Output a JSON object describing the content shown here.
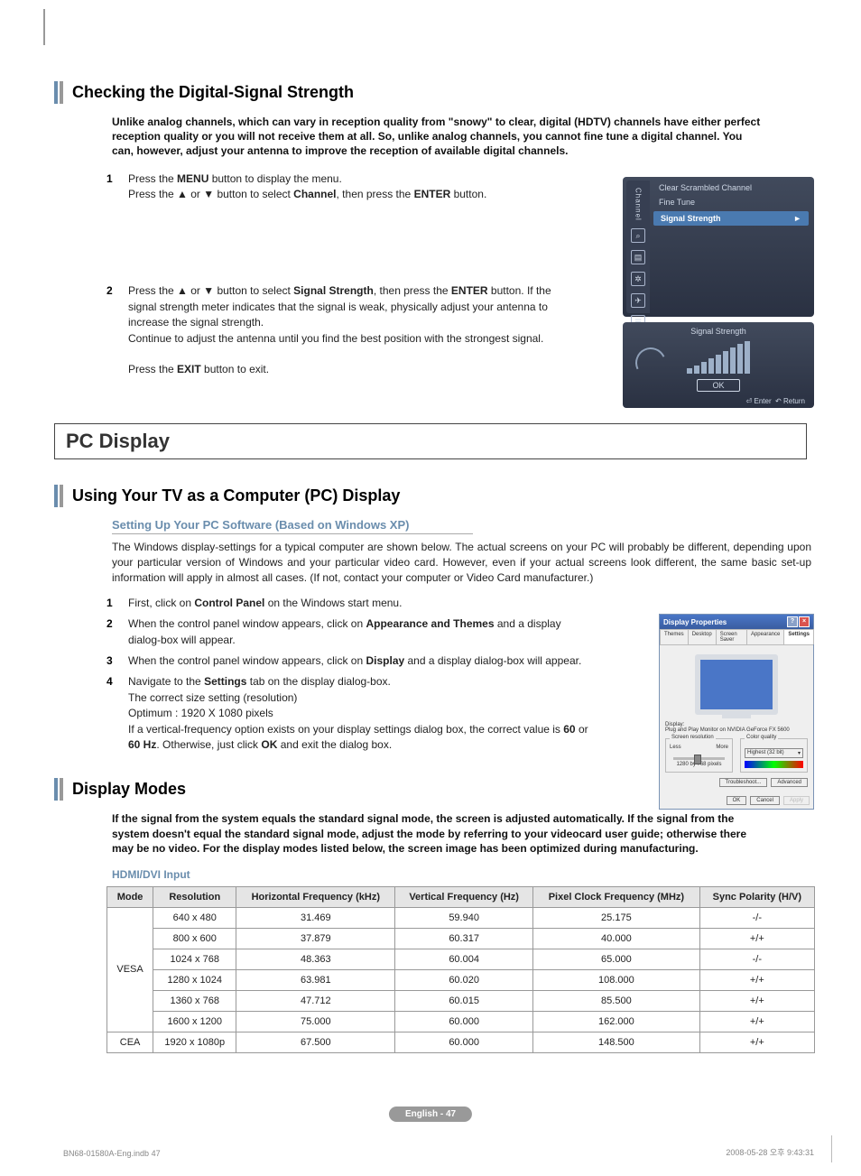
{
  "section1": {
    "title": "Checking the Digital-Signal Strength",
    "intro": "Unlike analog channels, which can vary in reception quality from \"snowy\" to clear, digital (HDTV) channels have either perfect reception quality or you will not receive them at all. So, unlike analog channels, you cannot fine tune a digital channel. You can, however, adjust your antenna to improve the reception of available digital channels.",
    "step1_num": "1",
    "step1_a": "Press the ",
    "step1_b": "MENU",
    "step1_c": " button to display the menu.",
    "step1_d": "Press the ▲ or ▼ button to select ",
    "step1_e": "Channel",
    "step1_f": ", then press the ",
    "step1_g": "ENTER",
    "step1_h": " button.",
    "step2_num": "2",
    "step2_a": "Press the ▲ or ▼ button to select ",
    "step2_b": "Signal Strength",
    "step2_c": ", then press the ",
    "step2_d": "ENTER",
    "step2_e": " button. If the signal strength meter indicates that the signal is weak, physically adjust your antenna to increase the signal strength.",
    "step2_f": "Continue to adjust the antenna until you find the best position with the strongest signal.",
    "step2_g": "Press the ",
    "step2_h": "EXIT",
    "step2_i": " button to exit."
  },
  "osd1": {
    "side_label": "Channel",
    "row1": "Clear Scrambled Channel",
    "row2": "Fine Tune",
    "row_sel": "Signal Strength",
    "arrow": "►"
  },
  "osd2": {
    "title": "Signal Strength",
    "ok": "OK",
    "enter": "Enter",
    "return": "Return"
  },
  "major": {
    "title": "PC Display"
  },
  "section2": {
    "title": "Using Your TV as a Computer (PC) Display",
    "sub": "Setting Up Your PC Software (Based on Windows XP)",
    "intro": "The Windows display-settings for a typical computer are shown below. The actual screens on your PC will probably be different, depending upon your particular version of Windows and your particular video card. However, even if your actual screens look different, the same basic set-up information will apply in almost all cases. (If not, contact your computer or Video Card manufacturer.)",
    "s1n": "1",
    "s1a": "First, click on ",
    "s1b": "Control Panel",
    "s1c": " on the Windows start menu.",
    "s2n": "2",
    "s2a": "When the control panel window appears, click on ",
    "s2b": "Appearance and Themes",
    "s2c": " and a display dialog-box will appear.",
    "s3n": "3",
    "s3a": "When the control panel window appears, click on ",
    "s3b": "Display",
    "s3c": " and a display dialog-box will appear.",
    "s4n": "4",
    "s4a": "Navigate to the ",
    "s4b": "Settings",
    "s4c": " tab on the display dialog-box.",
    "s4d": "The correct size setting (resolution)",
    "s4e": "Optimum : 1920 X 1080 pixels",
    "s4f": "If a vertical-frequency option exists on your display settings dialog box, the correct value is ",
    "s4g": "60",
    "s4h": " or ",
    "s4i": "60 Hz",
    "s4j": ". Otherwise, just click ",
    "s4k": "OK",
    "s4l": " and exit the dialog box."
  },
  "winxp": {
    "title": "Display Properties",
    "tabs": [
      "Themes",
      "Desktop",
      "Screen Saver",
      "Appearance",
      "Settings"
    ],
    "disp_label": "Display:",
    "disp_val": "Plug and Play Monitor on NVIDIA GeForce FX 5600",
    "fs1": "Screen resolution",
    "less": "Less",
    "more": "More",
    "res": "1280 by 768 pixels",
    "fs2": "Color quality",
    "cq": "Highest (32 bit)",
    "trouble": "Troubleshoot...",
    "adv": "Advanced",
    "ok": "OK",
    "cancel": "Cancel",
    "apply": "Apply"
  },
  "section3": {
    "title": "Display Modes",
    "intro": "If the signal from the system equals the standard signal mode, the screen is adjusted automatically. If the signal from the system doesn't equal the standard signal mode, adjust the mode by referring to your videocard user guide; otherwise there may be no video. For the display modes listed below, the screen image has been optimized during manufacturing.",
    "label": "HDMI/DVI Input"
  },
  "chart_data": {
    "type": "table",
    "headers": [
      "Mode",
      "Resolution",
      "Horizontal Frequency (kHz)",
      "Vertical Frequency (Hz)",
      "Pixel Clock Frequency (MHz)",
      "Sync Polarity (H/V)"
    ],
    "rows": [
      [
        "VESA",
        "640 x 480",
        "31.469",
        "59.940",
        "25.175",
        "-/-"
      ],
      [
        "VESA",
        "800 x 600",
        "37.879",
        "60.317",
        "40.000",
        "+/+"
      ],
      [
        "VESA",
        "1024 x 768",
        "48.363",
        "60.004",
        "65.000",
        "-/-"
      ],
      [
        "VESA",
        "1280 x 1024",
        "63.981",
        "60.020",
        "108.000",
        "+/+"
      ],
      [
        "VESA",
        "1360 x 768",
        "47.712",
        "60.015",
        "85.500",
        "+/+"
      ],
      [
        "VESA",
        "1600 x 1200",
        "75.000",
        "60.000",
        "162.000",
        "+/+"
      ],
      [
        "CEA",
        "1920 x 1080p",
        "67.500",
        "60.000",
        "148.500",
        "+/+"
      ]
    ],
    "mode_span": {
      "VESA": 6,
      "CEA": 1
    }
  },
  "footer": {
    "pill": "English - 47",
    "left": "BN68-01580A-Eng.indb   47",
    "right": "2008-05-28   오후 9:43:31"
  }
}
